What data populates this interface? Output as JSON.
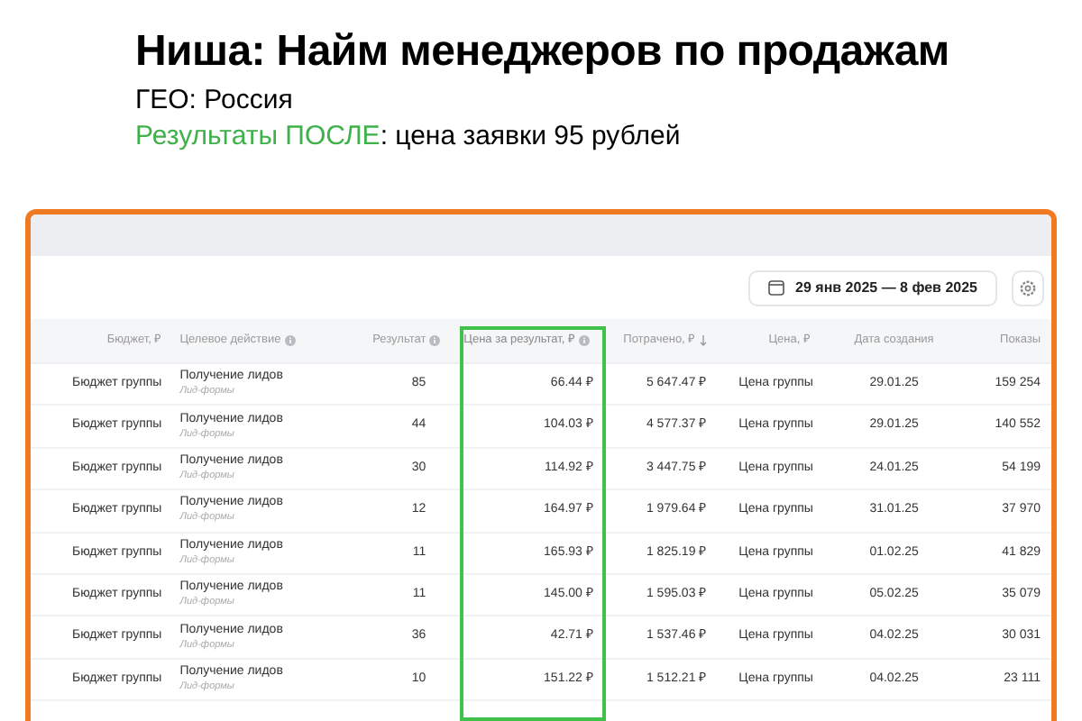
{
  "heading": {
    "title": "Ниша: Найм менеджеров по продажам",
    "geo": "ГЕО: Россия",
    "result": "**Результаты ПОСЛЕ**: цена заявки 95 рублей"
  },
  "toolbar": {
    "date_range": "29 янв 2025 — 8 фев 2025"
  },
  "table": {
    "columns": [
      {
        "label": "Бюджет, ₽",
        "info": false,
        "sorted": false,
        "highlighted": false
      },
      {
        "label": "Целевое действие",
        "info": true,
        "sorted": false,
        "highlighted": false
      },
      {
        "label": "Результат",
        "info": true,
        "sorted": false,
        "highlighted": false
      },
      {
        "label": "Цена за результат, ₽",
        "info": true,
        "sorted": false,
        "highlighted": true
      },
      {
        "label": "Потрачено, ₽",
        "info": false,
        "sorted": true,
        "highlighted": false
      },
      {
        "label": "Цена, ₽",
        "info": false,
        "sorted": false,
        "highlighted": false
      },
      {
        "label": "Дата создания",
        "info": false,
        "sorted": false,
        "highlighted": false
      },
      {
        "label": "Показы",
        "info": false,
        "sorted": false,
        "highlighted": false
      }
    ],
    "rows": [
      {
        "budget": "Бюджет группы",
        "action": "Получение лидов",
        "action_sub": "Лид-формы",
        "result": "85",
        "cost_per_result": "66.44 ₽",
        "spent": "5 647.47 ₽",
        "price": "Цена группы",
        "created": "29.01.25",
        "impressions": "159 254"
      },
      {
        "budget": "Бюджет группы",
        "action": "Получение лидов",
        "action_sub": "Лид-формы",
        "result": "44",
        "cost_per_result": "104.03 ₽",
        "spent": "4 577.37 ₽",
        "price": "Цена группы",
        "created": "29.01.25",
        "impressions": "140 552"
      },
      {
        "budget": "Бюджет группы",
        "action": "Получение лидов",
        "action_sub": "Лид-формы",
        "result": "30",
        "cost_per_result": "114.92 ₽",
        "spent": "3 447.75 ₽",
        "price": "Цена группы",
        "created": "24.01.25",
        "impressions": "54 199"
      },
      {
        "budget": "Бюджет группы",
        "action": "Получение лидов",
        "action_sub": "Лид-формы",
        "result": "12",
        "cost_per_result": "164.97 ₽",
        "spent": "1 979.64 ₽",
        "price": "Цена группы",
        "created": "31.01.25",
        "impressions": "37 970"
      },
      {
        "budget": "Бюджет группы",
        "action": "Получение лидов",
        "action_sub": "Лид-формы",
        "result": "11",
        "cost_per_result": "165.93 ₽",
        "spent": "1 825.19 ₽",
        "price": "Цена группы",
        "created": "01.02.25",
        "impressions": "41 829"
      },
      {
        "budget": "Бюджет группы",
        "action": "Получение лидов",
        "action_sub": "Лид-формы",
        "result": "11",
        "cost_per_result": "145.00 ₽",
        "spent": "1 595.03 ₽",
        "price": "Цена группы",
        "created": "05.02.25",
        "impressions": "35 079"
      },
      {
        "budget": "Бюджет группы",
        "action": "Получение лидов",
        "action_sub": "Лид-формы",
        "result": "36",
        "cost_per_result": "42.71 ₽",
        "spent": "1 537.46 ₽",
        "price": "Цена группы",
        "created": "04.02.25",
        "impressions": "30 031"
      },
      {
        "budget": "Бюджет группы",
        "action": "Получение лидов",
        "action_sub": "Лид-формы",
        "result": "10",
        "cost_per_result": "151.22 ₽",
        "spent": "1 512.21 ₽",
        "price": "Цена группы",
        "created": "04.02.25",
        "impressions": "23 111"
      }
    ]
  }
}
